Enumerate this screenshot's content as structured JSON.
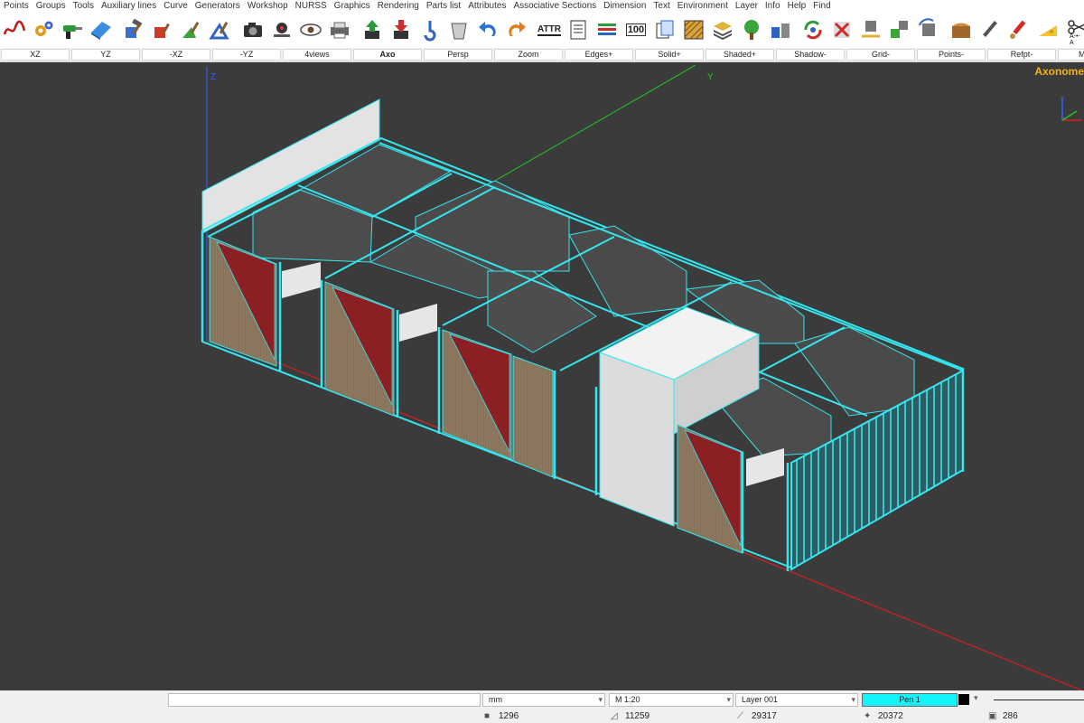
{
  "menu": [
    "Points",
    "Groups",
    "Tools",
    "Auxiliary lines",
    "Curve",
    "Generators",
    "Workshop",
    "NURSS",
    "Graphics",
    "Rendering",
    "Parts list",
    "Attributes",
    "Associative Sections",
    "Dimension",
    "Text",
    "Environment",
    "Layer",
    "Info",
    "Help",
    "Find"
  ],
  "toolbar": {
    "attr_label": "ATTR",
    "hundred_label": "100",
    "atoa_label": "A-•-A"
  },
  "views": [
    {
      "label": "XZ"
    },
    {
      "label": "YZ"
    },
    {
      "label": "-XZ"
    },
    {
      "label": "-YZ"
    },
    {
      "label": "4views"
    },
    {
      "label": "Axo",
      "active": true
    },
    {
      "label": "Persp"
    },
    {
      "label": "Zoom"
    },
    {
      "label": "Edges+"
    },
    {
      "label": "Solid+"
    },
    {
      "label": "Shaded+"
    },
    {
      "label": "Shadow-"
    },
    {
      "label": "Grid-"
    },
    {
      "label": "Points-"
    },
    {
      "label": "Refpt-"
    },
    {
      "label": "Materia"
    }
  ],
  "viewport": {
    "view_name": "Axonome",
    "axis_z": "Z",
    "axis_y": "Y",
    "colors": {
      "background": "#3b3b3b",
      "frame": "#35e6ef",
      "wood": "#8e7a60",
      "red_panel": "#8c1f23",
      "felt": "#4a4a4a",
      "white": "#e6e6e6"
    }
  },
  "status": {
    "units": "mm",
    "scale": "M 1:20",
    "layer": "Layer 001",
    "pen": "Pen 1",
    "counts": {
      "solids": "1296",
      "faces": "11259",
      "edges": "29317",
      "points": "20372",
      "groups": "286"
    }
  }
}
